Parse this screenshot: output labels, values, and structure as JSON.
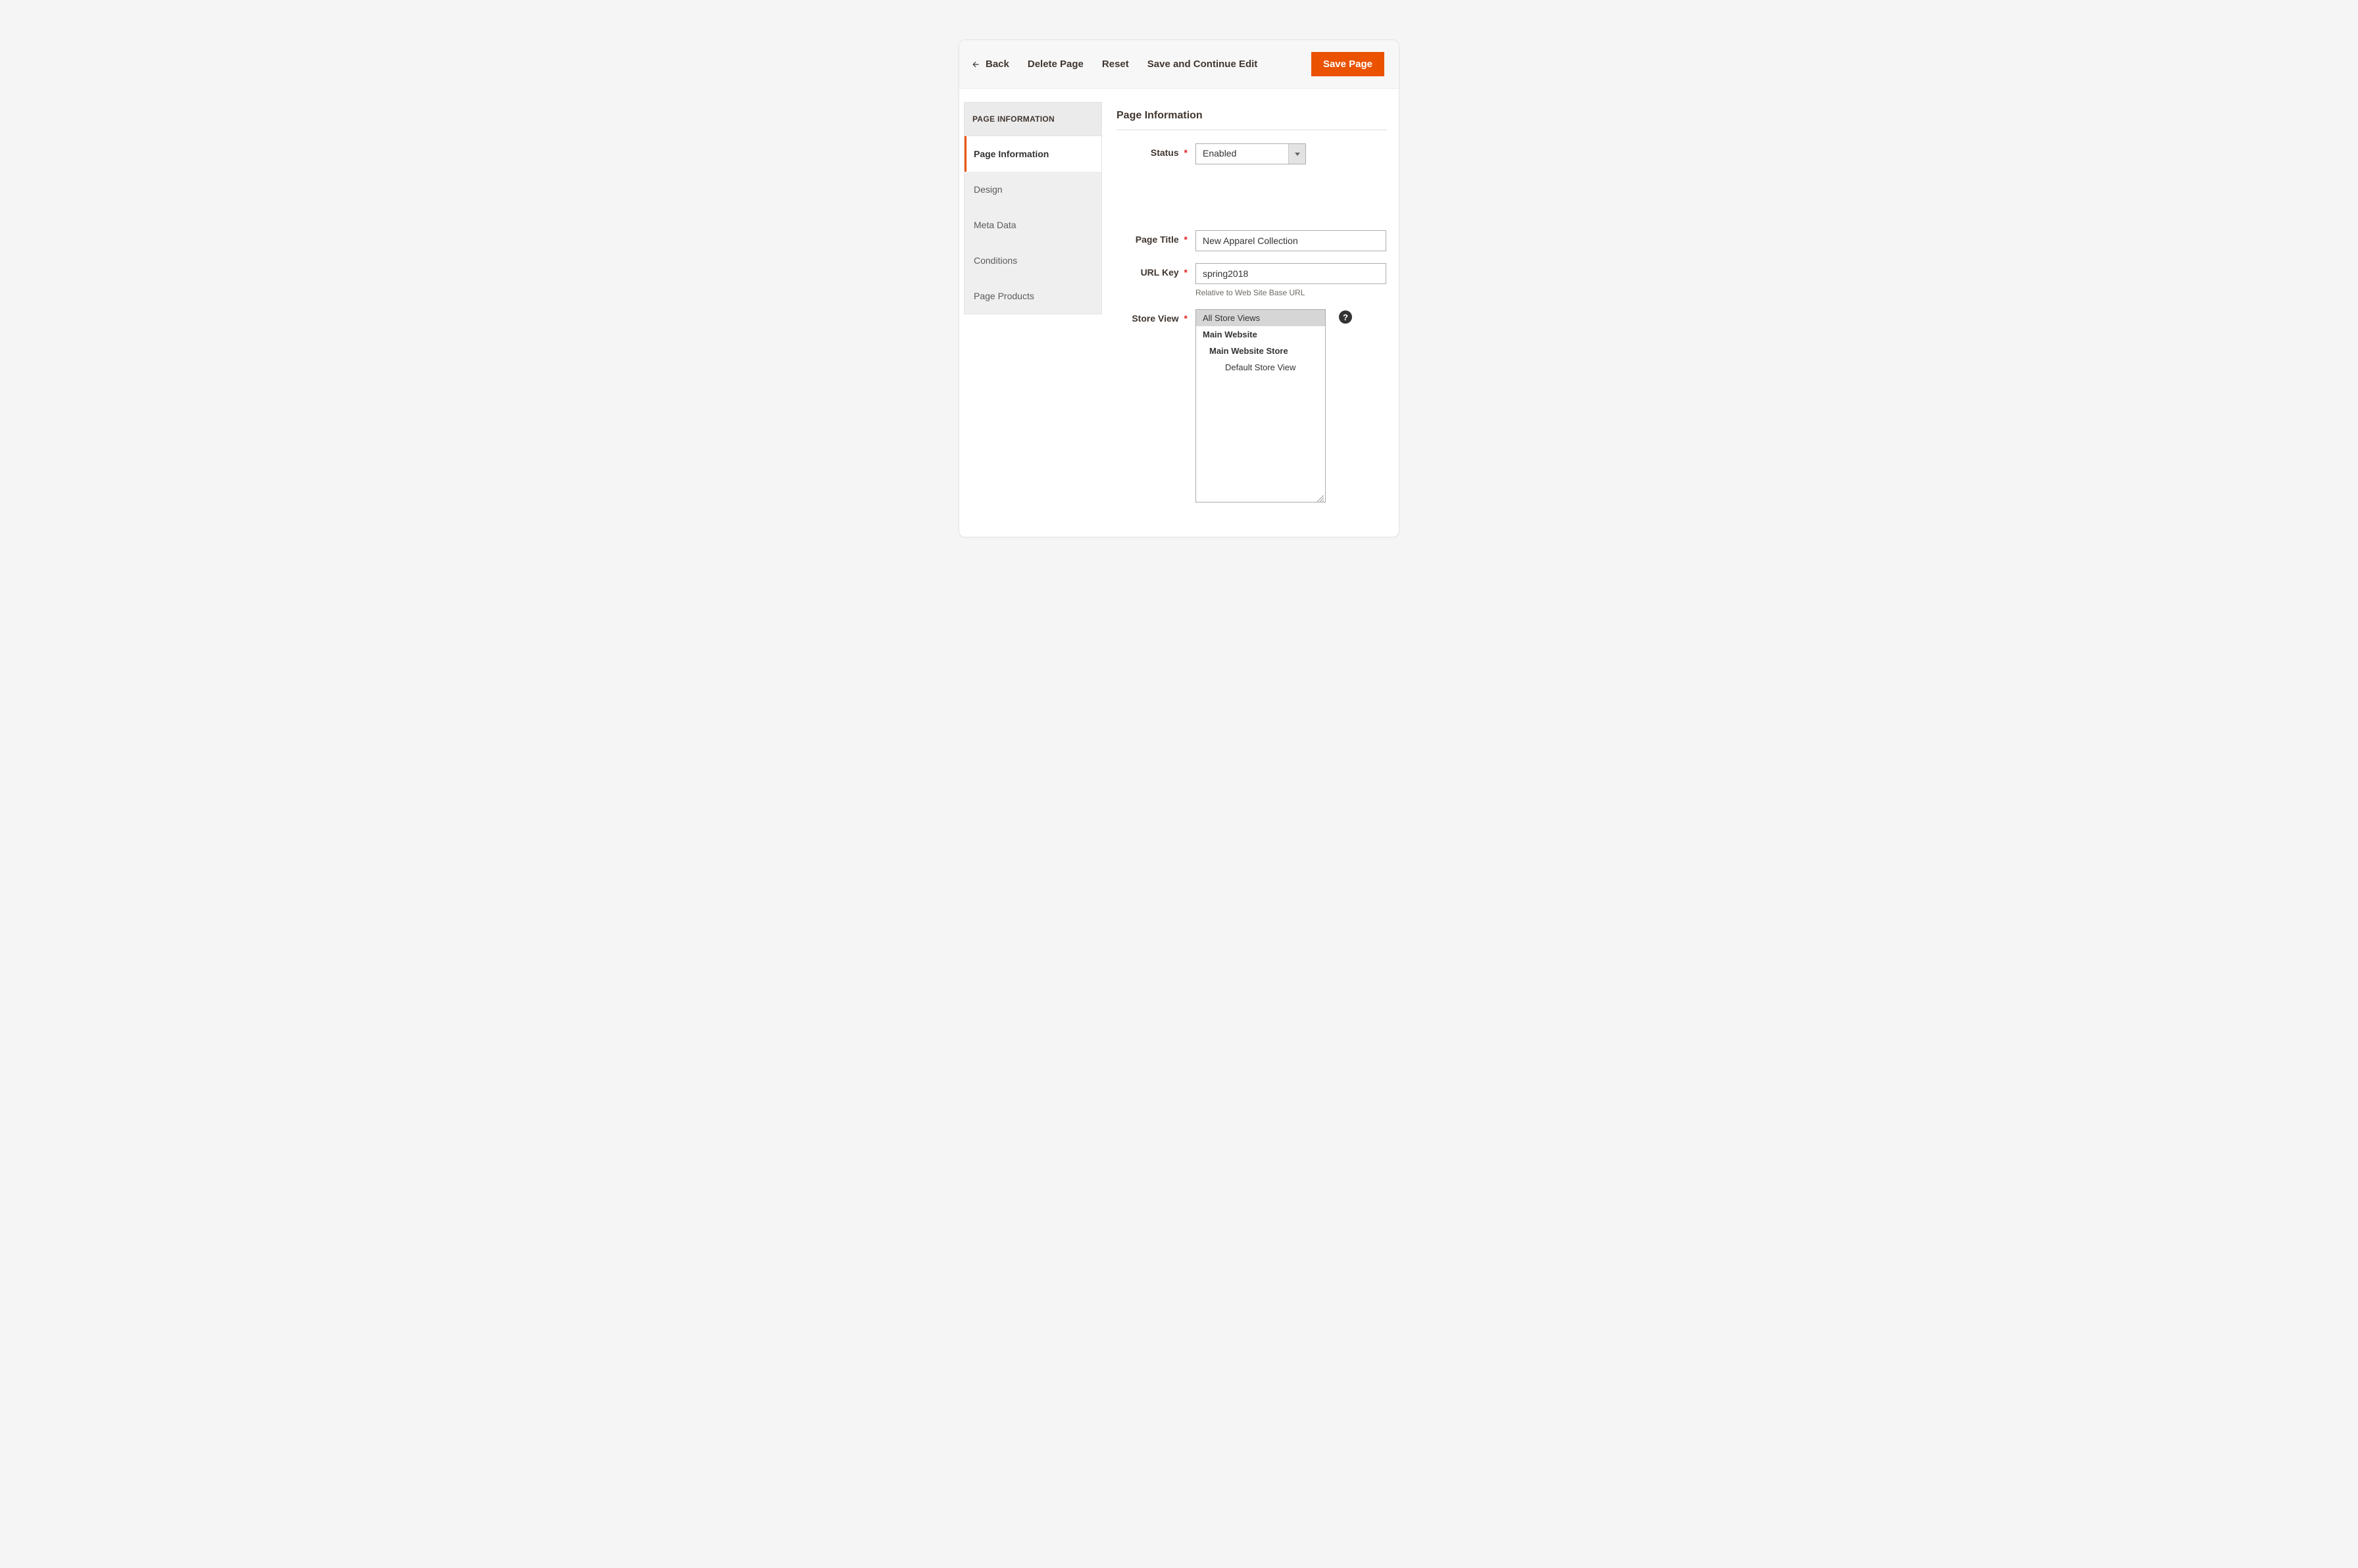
{
  "toolbar": {
    "back": "Back",
    "delete": "Delete Page",
    "reset": "Reset",
    "save_continue": "Save and Continue Edit",
    "save": "Save Page"
  },
  "sidebar": {
    "header": "PAGE INFORMATION",
    "tabs": {
      "page_info": "Page Information",
      "design": "Design",
      "meta": "Meta Data",
      "conditions": "Conditions",
      "products": "Page Products"
    }
  },
  "section": {
    "title": "Page Information"
  },
  "form": {
    "status_label": "Status",
    "status_value": "Enabled",
    "pagetitle_label": "Page Title",
    "pagetitle_value": "New Apparel Collection",
    "urlkey_label": "URL Key",
    "urlkey_value": "spring2018",
    "urlkey_hint": "Relative to Web Site Base URL",
    "storeview_label": "Store View",
    "storeview": {
      "all": "All Store Views",
      "main_website": "Main Website",
      "main_store": "Main Website Store",
      "default_view": "Default Store View"
    }
  },
  "asterisk": "*",
  "help": "?"
}
